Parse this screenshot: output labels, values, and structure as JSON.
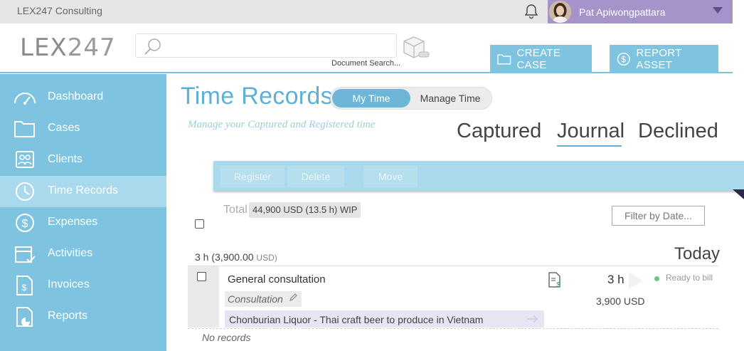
{
  "app": {
    "title": "LEX247 Consulting"
  },
  "user": {
    "name": "Pat Apiwongpattara"
  },
  "header": {
    "logo_bold": "LEX",
    "logo_thin": "247",
    "search": {
      "placeholder": "",
      "doc_search_label": "Document Search..."
    },
    "create_case_label": "CREATE CASE",
    "report_asset_label": "REPORT ASSET"
  },
  "sidebar": {
    "items": [
      {
        "label": "Dashboard",
        "icon": "gauge-icon",
        "active": false
      },
      {
        "label": "Cases",
        "icon": "folder-icon",
        "active": false
      },
      {
        "label": "Clients",
        "icon": "contacts-icon",
        "active": false
      },
      {
        "label": "Time Records",
        "icon": "clock-icon",
        "active": true
      },
      {
        "label": "Expenses",
        "icon": "dollar-icon",
        "active": false
      },
      {
        "label": "Activities",
        "icon": "calendar-check-icon",
        "active": false
      },
      {
        "label": "Invoices",
        "icon": "invoice-icon",
        "active": false
      },
      {
        "label": "Reports",
        "icon": "report-icon",
        "active": false
      }
    ]
  },
  "main": {
    "title": "Time Records",
    "toggle": {
      "mine": "My Time",
      "manage": "Manage Time",
      "selected": "My Time"
    },
    "subtitle": "Manage your Captured and Registered time",
    "tabs": {
      "captured": "Captured",
      "journal": "Journal",
      "declined": "Declined",
      "active": "Journal"
    },
    "actions": {
      "register": "Register",
      "delete": "Delete",
      "move": "Move"
    },
    "total_label": "Total",
    "total_value": "44,900 USD (13.5 h)  WIP",
    "filter_label": "Filter by Date...",
    "group": {
      "hours": "3 h",
      "amount": "(3,900.00",
      "currency": "USD)",
      "day": "Today"
    },
    "entry": {
      "title": "General consultation",
      "type": "Consultation",
      "matter": "Chonburian Liquor - Thai craft beer to produce in Vietnam",
      "hours": "3 h",
      "amount": "3,900 USD",
      "status": "Ready to bill",
      "status_color": "#6cc48c"
    },
    "no_records": "No records"
  },
  "colors": {
    "accent": "#7ec4e0",
    "title": "#5fb0d4",
    "user_chip": "#a494c9",
    "active_nav": "#a9d9ec"
  }
}
